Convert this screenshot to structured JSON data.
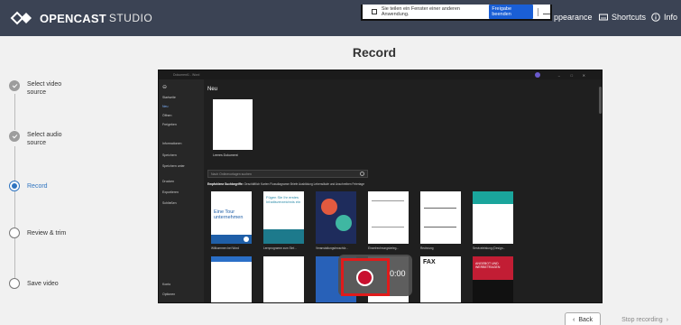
{
  "header": {
    "brand": "OPENCAST",
    "brand_sub": "STUDIO",
    "appearance_label": "ppearance",
    "shortcuts_label": "Shortcuts",
    "info_label": "Info"
  },
  "share_banner": {
    "text": "Sie teilen ein Fenster einer anderen Anwendung.",
    "stop_label": "Freigabe beenden"
  },
  "stepper": {
    "steps": [
      {
        "label": "Select video source",
        "state": "done"
      },
      {
        "label": "Select audio source",
        "state": "done"
      },
      {
        "label": "Record",
        "state": "active"
      },
      {
        "label": "Review & trim",
        "state": "pending"
      },
      {
        "label": "Save video",
        "state": "pending"
      }
    ]
  },
  "main": {
    "title": "Record"
  },
  "preview": {
    "window_title": "Dokument1 - Word",
    "sidebar_items": [
      "Startseite",
      "Neu",
      "Öffnen",
      "Freigeben",
      "Informationen",
      "Speichern",
      "Speichern unter",
      "Drucken",
      "Exportieren",
      "Schließen",
      "Konto",
      "Optionen"
    ],
    "section_new": "Neu",
    "blank_doc_label": "Leeres Dokument",
    "search_placeholder": "Nach Onlinevorlagen suchen",
    "categories_bold": "Empfohlene Suchbegriffe:",
    "categories": "Geschäftlich   Karten   Flussdiagramm   Briefe   Ausbildung   Lebensläufe und Anschreiben   Feiertage",
    "templates": [
      {
        "label": "Willkommen bei Word",
        "text": "Eine Tour unternehmen"
      },
      {
        "label": "Lernprogramm zum Einf...",
        "text": "Fügen Sie Ihr erstes Inhaltsverzeichnis ein"
      },
      {
        "label": "Veranstaltungsbroschür...",
        "text": ""
      },
      {
        "label": "Einzelrechnungsbeleg...",
        "text": ""
      },
      {
        "label": "Rechnung",
        "text": ""
      },
      {
        "label": "Serviceleistung (Design...",
        "text": ""
      }
    ],
    "row2_texts": [
      "",
      "",
      "",
      "",
      "FAX",
      "ANGEBOT UND WERBETRAGEN"
    ]
  },
  "recorder": {
    "time": "0:00"
  },
  "footer": {
    "back_label": "Back",
    "stop_label": "Stop recording"
  },
  "colors": {
    "header_bg": "#3b4354",
    "accent": "#2f74c0",
    "record_red": "#c8102e"
  }
}
